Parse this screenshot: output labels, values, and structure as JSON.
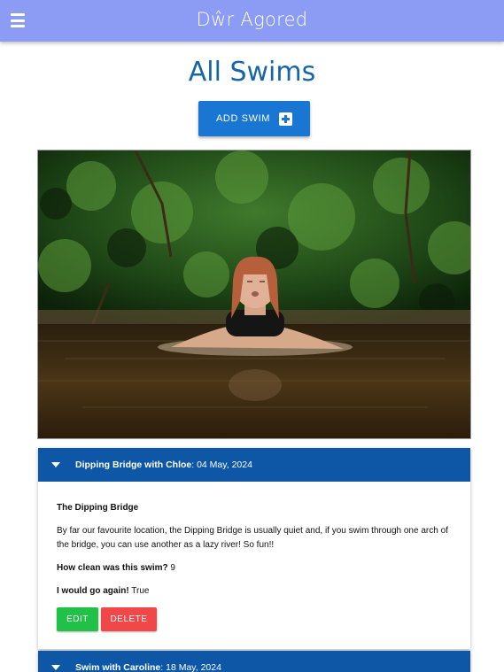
{
  "navbar": {
    "brand": "Dŵr Agored"
  },
  "page": {
    "title": "All Swims",
    "add_button": "ADD SWIM"
  },
  "swims": [
    {
      "title": "Dipping Bridge with Chloe",
      "date": ": 04 May, 2024",
      "location": "The Dipping Bridge",
      "description": "By far our favourite location, the Dipping Bridge is usually quiet and, if you swim through one arch of the bridge, you can use another as a lazy river! So fun!!",
      "clean_label": "How clean was this swim?",
      "clean_value": " 9",
      "again_label": "I would go again!",
      "again_value": " True",
      "edit_label": "EDIT",
      "delete_label": "DELETE"
    },
    {
      "title": "Swim with Caroline",
      "date": ": 18 May, 2024"
    }
  ],
  "colors": {
    "navbar": "#8c9cf4",
    "primary": "#1976d2",
    "card_header": "#0d57a6",
    "edit": "#21c046",
    "delete": "#f04848"
  }
}
